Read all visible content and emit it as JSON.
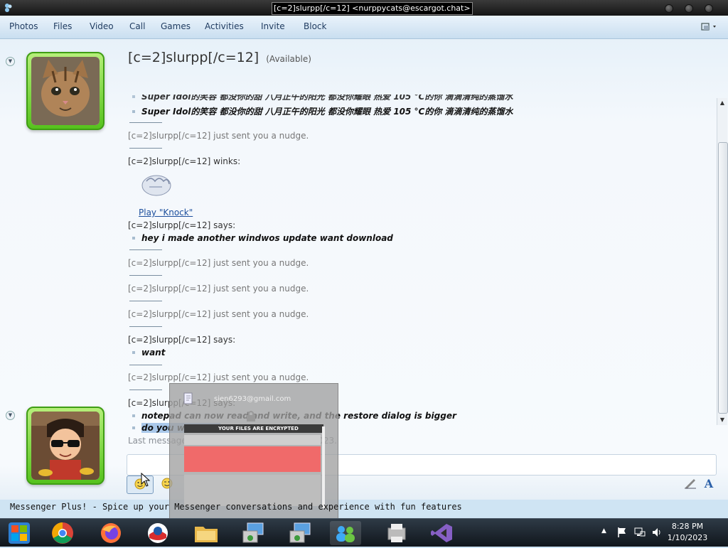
{
  "window": {
    "title": "[c=2]slurpp[/c=12] <nurppycats@escargot.chat>"
  },
  "menu": [
    "Photos",
    "Files",
    "Video",
    "Call",
    "Games",
    "Activities",
    "Invite",
    "Block"
  ],
  "contact": {
    "name": "[c=2]slurpp[/c=12]",
    "status": "(Available)"
  },
  "conversation": {
    "cut_line": "Super Idol的笑容 都没你的甜 八月正午的阳光 都没你耀眼 热爱 105 °C的你 滴滴清纯的蒸馏水",
    "line1": "Super Idol的笑容 都没你的甜 八月正午的阳光 都没你耀眼 热爱 105 °C的你 滴滴清纯的蒸馏水",
    "nudge": "[c=2]slurpp[/c=12] just sent you a nudge.",
    "winks": "[c=2]slurpp[/c=12] winks:",
    "play_link": "Play \"Knock\"",
    "says": "[c=2]slurpp[/c=12] says:",
    "msg_update": "hey i made another windwos update want download",
    "msg_want": "want",
    "msg_notepad": "notepad can now read and write, and the restore dialog is bigger",
    "msg_exe": "do you want exe"
  },
  "last_message": "Last message received at 8:25 PM on 1/10/2023.",
  "popup": {
    "email": "sien6293@gmail.com",
    "header": "YOUR FILES ARE ENCRYPTED"
  },
  "status_line": "Messenger Plus! - Spice up your Messenger conversations and experience with fun features",
  "clock": {
    "time": "8:28 PM",
    "date": "1/10/2023"
  },
  "colors": {
    "avatar_frame": "#56c21d",
    "link": "#1c4e9c",
    "popup_red": "#f06a6a"
  }
}
